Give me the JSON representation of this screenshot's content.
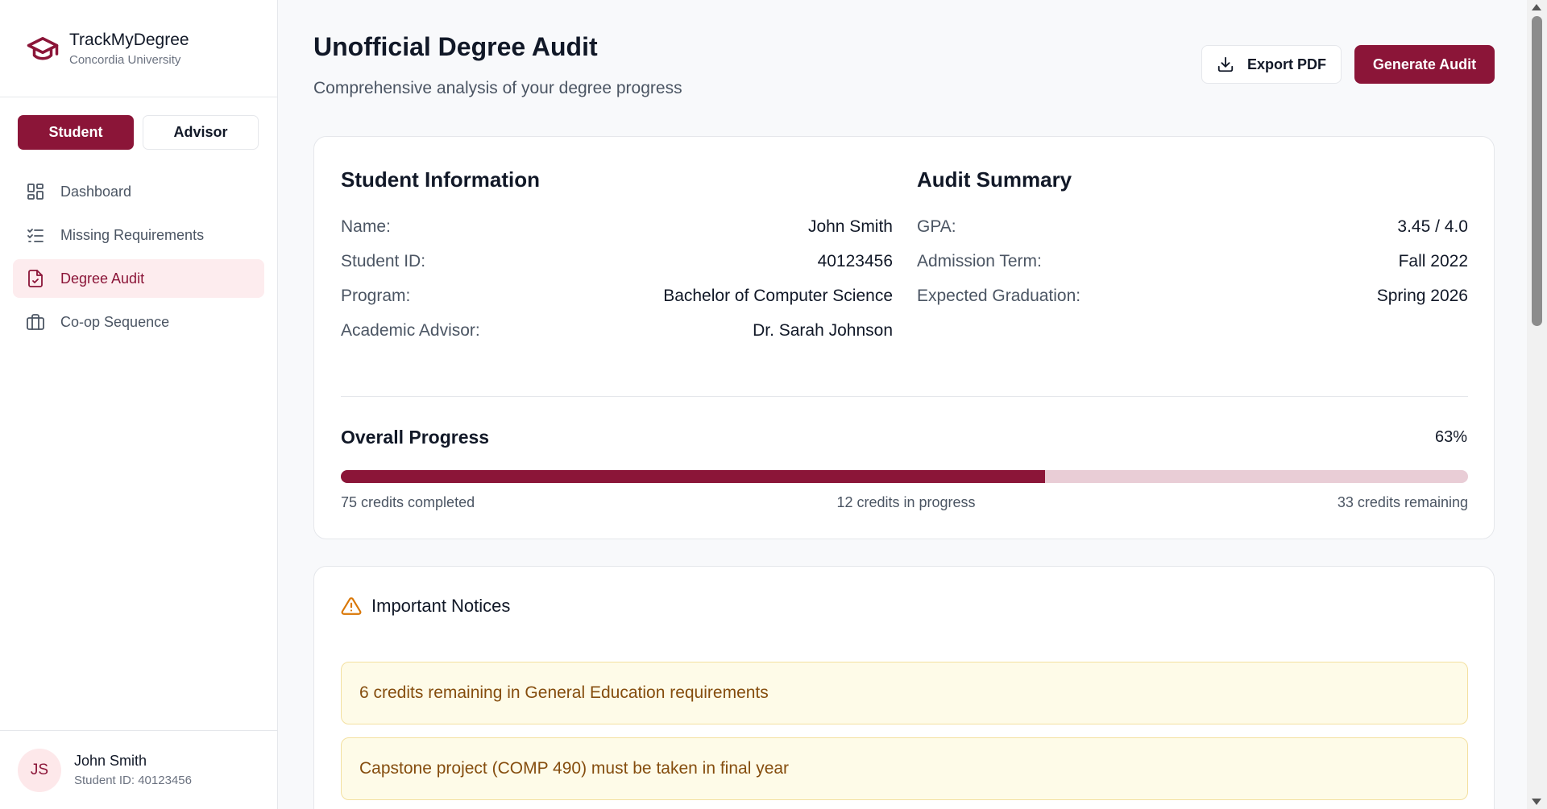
{
  "brand": {
    "title": "TrackMyDegree",
    "subtitle": "Concordia University"
  },
  "roles": {
    "student": "Student",
    "advisor": "Advisor",
    "active": "Student"
  },
  "nav": [
    {
      "label": "Dashboard",
      "icon": "dashboard-icon",
      "active": false
    },
    {
      "label": "Missing Requirements",
      "icon": "checklist-icon",
      "active": false
    },
    {
      "label": "Degree Audit",
      "icon": "document-check-icon",
      "active": true
    },
    {
      "label": "Co-op Sequence",
      "icon": "briefcase-icon",
      "active": false
    }
  ],
  "user": {
    "initials": "JS",
    "name": "John Smith",
    "id_text": "Student ID: 40123456"
  },
  "header": {
    "title": "Unofficial Degree Audit",
    "subtitle": "Comprehensive analysis of your degree progress",
    "export_label": "Export PDF",
    "generate_label": "Generate Audit"
  },
  "student_info": {
    "title": "Student Information",
    "rows": [
      {
        "label": "Name:",
        "value": "John Smith"
      },
      {
        "label": "Student ID:",
        "value": "40123456"
      },
      {
        "label": "Program:",
        "value": "Bachelor of Computer Science"
      },
      {
        "label": "Academic Advisor:",
        "value": "Dr. Sarah Johnson"
      }
    ]
  },
  "audit_summary": {
    "title": "Audit Summary",
    "rows": [
      {
        "label": "GPA:",
        "value": "3.45 / 4.0"
      },
      {
        "label": "Admission Term:",
        "value": "Fall 2022"
      },
      {
        "label": "Expected Graduation:",
        "value": "Spring 2026"
      }
    ]
  },
  "progress": {
    "title": "Overall Progress",
    "percent_text": "63%",
    "fill_fraction": 0.625,
    "completed": "75 credits completed",
    "in_progress": "12 credits in progress",
    "remaining": "33 credits remaining"
  },
  "notices": {
    "title": "Important Notices",
    "items": [
      "6 credits remaining in General Education requirements",
      "Capstone project (COMP 490) must be taken in final year"
    ]
  },
  "colors": {
    "accent": "#8b1538",
    "accent_light": "#fdecee",
    "warning": "#d97706"
  }
}
